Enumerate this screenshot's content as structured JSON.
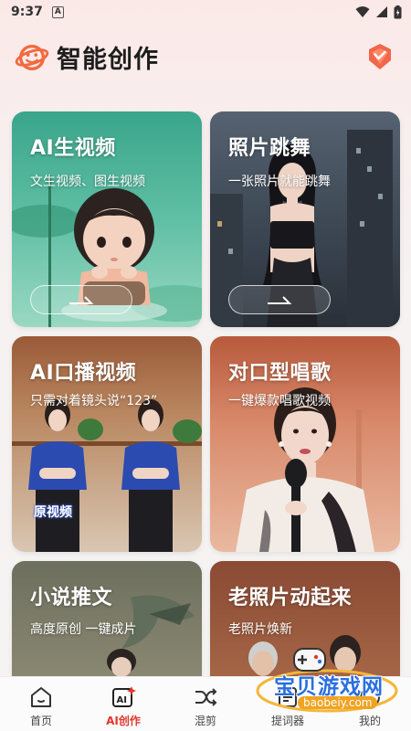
{
  "status_bar": {
    "time": "9:37",
    "notif_glyph": "A"
  },
  "header": {
    "title": "智能创作"
  },
  "cards": [
    {
      "title": "AI生视频",
      "subtitle": "文生视频、图生视频"
    },
    {
      "title": "照片跳舞",
      "subtitle": "一张照片就能跳舞"
    },
    {
      "title": "AI口播视频",
      "subtitle": "只需对着镜头说“123”",
      "tag": "原视频"
    },
    {
      "title": "对口型唱歌",
      "subtitle": "一键爆款唱歌视频"
    },
    {
      "title": "小说推文",
      "subtitle": "高度原创 一键成片"
    },
    {
      "title": "老照片动起来",
      "subtitle": "老照片焕新"
    }
  ],
  "nav": [
    {
      "label": "首页"
    },
    {
      "label": "AI创作"
    },
    {
      "label": "混剪"
    },
    {
      "label": "提词器"
    },
    {
      "label": "我的"
    }
  ],
  "active_nav": "AI创作",
  "watermark": {
    "name": "宝贝游戏网",
    "url": "baobeiy.com"
  },
  "colors": {
    "accent": "#e2372b",
    "logo": "#f26a3f"
  }
}
